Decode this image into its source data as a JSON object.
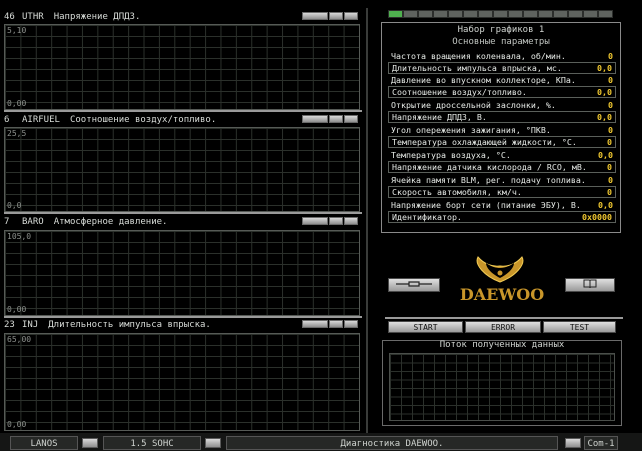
{
  "graphs": [
    {
      "num": "46",
      "code": "UTHR",
      "desc": "Напряжение ДПДЗ.",
      "ymax": "5,10",
      "ymin": "0,00"
    },
    {
      "num": "6",
      "code": "AIRFUEL",
      "desc": "Соотношение воздух/топливо.",
      "ymax": "25,5",
      "ymin": "0,0"
    },
    {
      "num": "7",
      "code": "BARO",
      "desc": "Атмосферное давление.",
      "ymax": "105,0",
      "ymin": "0,00"
    },
    {
      "num": "23",
      "code": "INJ",
      "desc": "Длительность импульса впрыска.",
      "ymax": "65,00",
      "ymin": "0,00"
    }
  ],
  "params": {
    "set_title": "Набор графиков 1",
    "group_title": "Основные параметры",
    "rows": [
      {
        "label": "Частота вращения коленвала, об/мин.",
        "value": "0"
      },
      {
        "label": "Длительность импульса впрыска, мс.",
        "value": "0,0"
      },
      {
        "label": "Давление во впускном коллекторе, КПа.",
        "value": "0"
      },
      {
        "label": "Соотношение воздух/топливо.",
        "value": "0,0"
      },
      {
        "label": "Открытие дроссельной заслонки, %.",
        "value": "0"
      },
      {
        "label": "Напряжение ДПДЗ, В.",
        "value": "0,0"
      },
      {
        "label": "Угол опережения зажигания, °ПКВ.",
        "value": "0"
      },
      {
        "label": "Температура охлаждающей жидкости, °С.",
        "value": "0"
      },
      {
        "label": "Температура воздуха, °С.",
        "value": "0,0"
      },
      {
        "label": "Напряжение датчика кислорода / RCO, мВ.",
        "value": "0"
      },
      {
        "label": "Ячейка памяти BLM, рег. подачу топлива.",
        "value": "0"
      },
      {
        "label": "Скорость автомобиля, км/ч.",
        "value": "0"
      },
      {
        "label": "Напряжение борт сети (питание ЭБУ), В.",
        "value": "0,0"
      },
      {
        "label": "Идентификатор.",
        "value": "0x0000"
      }
    ]
  },
  "brand": "DAEWOO",
  "buttons": {
    "start": "START",
    "error": "ERROR",
    "test": "TEST"
  },
  "stream_title": "Поток полученных данных",
  "statusbar": {
    "car": "LANOS",
    "engine": "1.5 SOHC",
    "app": "Диагностика DAEWOO.",
    "port": "Com-1"
  },
  "colors": {
    "accent": "#f0c830",
    "logo": "#c9962a"
  }
}
